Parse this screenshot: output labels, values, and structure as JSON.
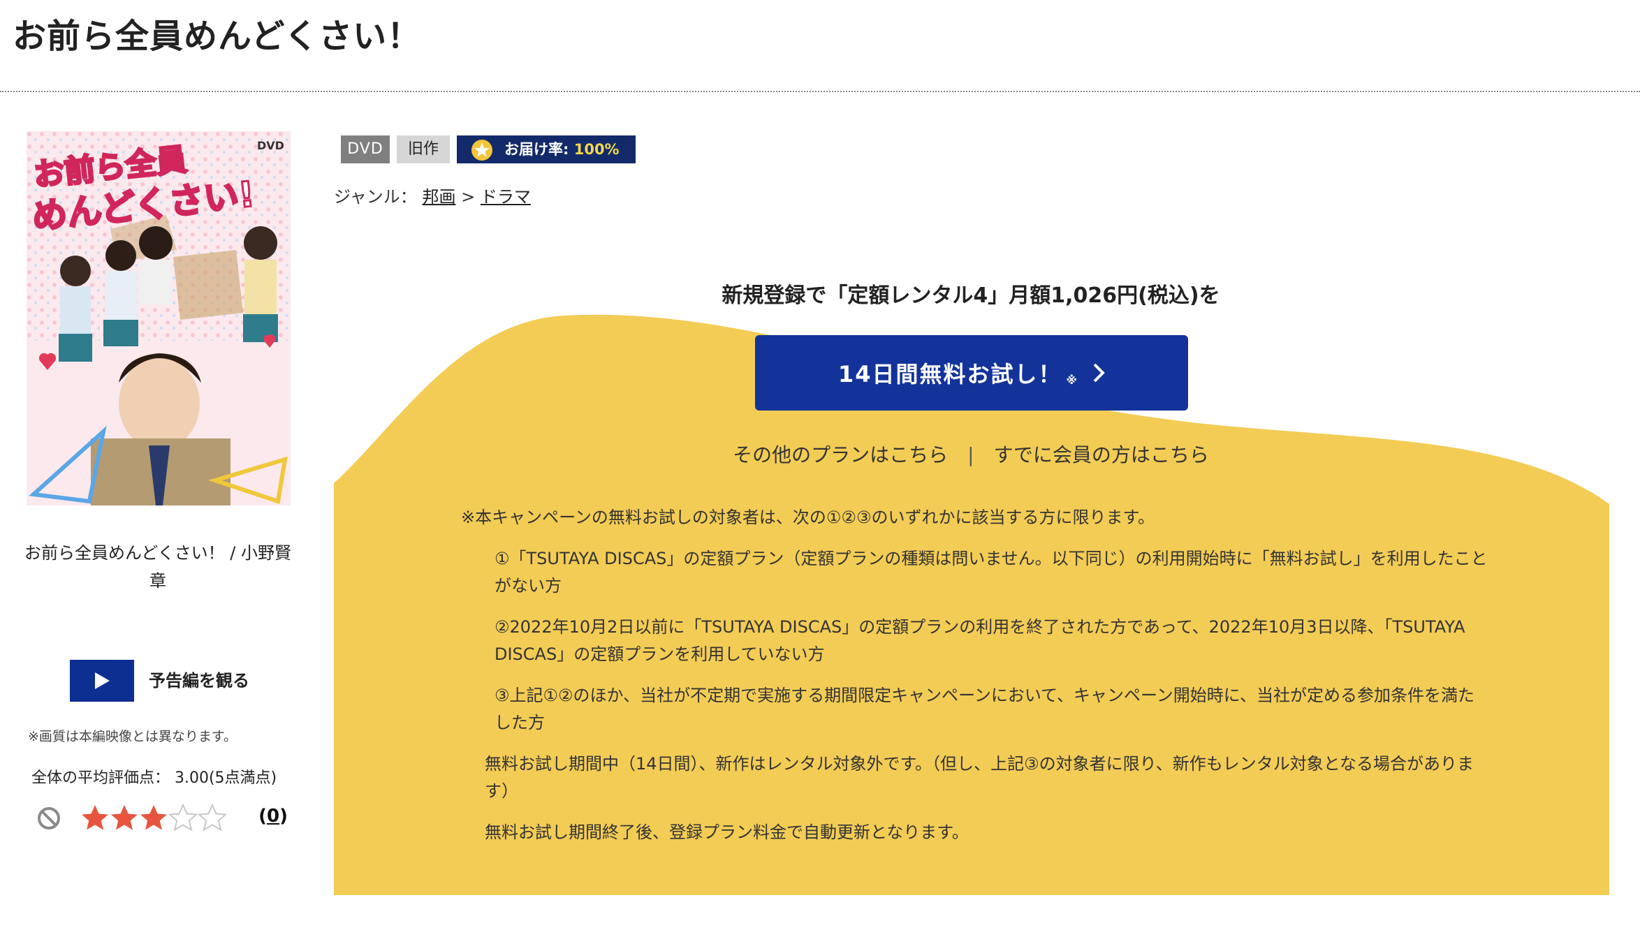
{
  "page": {
    "title": "お前ら全員めんどくさい！"
  },
  "cover": {
    "title_art_line1": "お前ら全員",
    "title_art_line2": "めんどくさい!",
    "dvd_mark": "DVD",
    "caption": "お前ら全員めんどくさい！ / 小野賢章"
  },
  "trailer": {
    "label": "予告編を観る",
    "note": "※画質は本編映像とは異なります。"
  },
  "rating": {
    "avg_text": "全体の平均評価点： 3.00(5点満点)",
    "value": 3,
    "max": 5,
    "review_count_prefix": "(",
    "review_count": "0",
    "review_count_suffix": ")"
  },
  "badges": {
    "dvd": "DVD",
    "old": "旧作",
    "delivery_label": "お届け率:",
    "delivery_rate": "100%"
  },
  "genre": {
    "label": "ジャンル：",
    "primary": "邦画",
    "sep": ">",
    "secondary": "ドラマ"
  },
  "promo": {
    "headline": "新規登録で「定額レンタル4」月額1,026円(税込)を",
    "button_label": "14日間無料お試し！",
    "button_mark": "※",
    "other_plans": "その他のプランはこちら",
    "separator": "|",
    "member_link": "すでに会員の方はこちら",
    "colors": {
      "yellow": "#f3cc55",
      "button_blue": "#14339a"
    }
  },
  "notes": {
    "head": "※本キャンペーンの無料お試しの対象者は、次の①②③のいずれかに該当する方に限ります。",
    "item1": "①「TSUTAYA DISCAS」の定額プラン（定額プランの種類は問いません。以下同じ）の利用開始時に「無料お試し」を利用したことがない方",
    "item2": "②2022年10月2日以前に「TSUTAYA DISCAS」の定額プランの利用を終了された方であって、2022年10月3日以降、「TSUTAYA DISCAS」の定額プランを利用していない方",
    "item3": "③上記①②のほか、当社が不定期で実施する期間限定キャンペーンにおいて、キャンペーン開始時に、当社が定める参加条件を満たした方",
    "trial_period": "無料お試し期間中（14日間）、新作はレンタル対象外です。（但し、上記③の対象者に限り、新作もレンタル対象となる場合があります）",
    "auto_renew": "無料お試し期間終了後、登録プラン料金で自動更新となります。"
  }
}
